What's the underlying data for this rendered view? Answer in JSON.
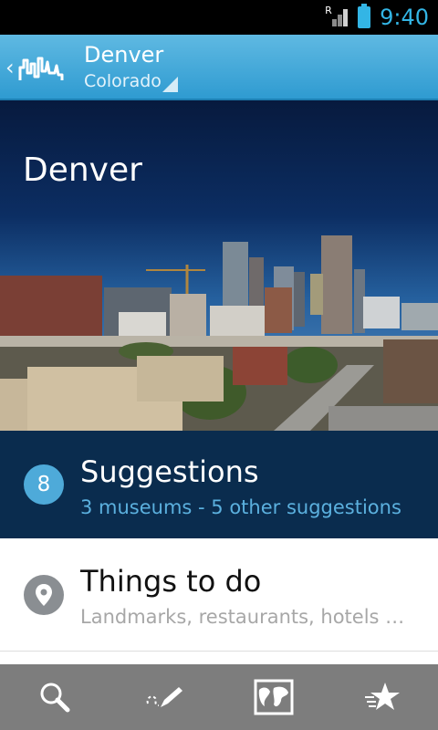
{
  "status_bar": {
    "network": "R",
    "time": "9:40",
    "icons": [
      "signal-icon",
      "battery-icon"
    ]
  },
  "action_bar": {
    "title": "Denver",
    "subtitle": "Colorado",
    "icons": [
      "back-caret-icon",
      "skyline-logo-icon"
    ]
  },
  "hero": {
    "title": "Denver"
  },
  "suggestions": {
    "count": "8",
    "title": "Suggestions",
    "subtitle": "3 museums - 5 other suggestions"
  },
  "things_to_do": {
    "title": "Things to do",
    "subtitle": "Landmarks, restaurants, hotels …",
    "icon": "location-pin-icon"
  },
  "bottom_bar": {
    "icons": [
      "search-icon",
      "edit-pencil-icon",
      "world-map-icon",
      "favorites-star-icon"
    ]
  },
  "colors": {
    "accent": "#33b5e5",
    "action_bar": "#3aa7dc",
    "suggestions_bg": "#0a2c4e",
    "badge": "#4eaad9",
    "bottom_bar": "#7d7d7d"
  }
}
